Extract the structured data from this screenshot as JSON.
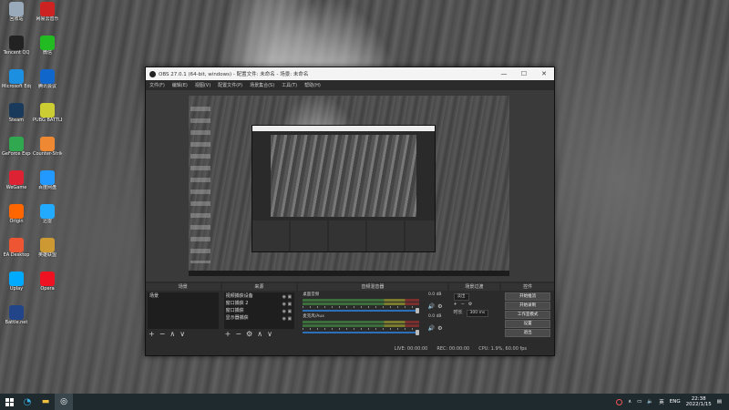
{
  "window": {
    "title": "OBS 27.0.1 (64-bit, windows) - 配置文件: 未命名 - 场景: 未命名",
    "min_glyph": "—",
    "max_glyph": "☐",
    "close_glyph": "✕"
  },
  "menu": [
    "文件(F)",
    "编辑(E)",
    "视图(V)",
    "配置文件(P)",
    "场景集合(S)",
    "工具(T)",
    "帮助(H)"
  ],
  "docks": {
    "scenes": {
      "title": "场景",
      "items": [
        "场景"
      ]
    },
    "sources": {
      "title": "来源",
      "items": [
        "视频捕获设备",
        "窗口捕获 2",
        "窗口捕获",
        "显示器捕获"
      ]
    },
    "mixer": {
      "title": "音频混音器",
      "channels": [
        {
          "name": "桌面音频",
          "db": "0.0 dB",
          "level": 0.9
        },
        {
          "name": "麦克风/Aux",
          "db": "0.0 dB",
          "level": 0.9
        }
      ]
    },
    "transitions": {
      "title": "场景过渡",
      "type": "淡出",
      "duration_label": "时长",
      "duration": "300 ms"
    },
    "controls": {
      "title": "控件",
      "buttons": [
        "开始推流",
        "开始录制",
        "工作室模式",
        "设置",
        "退出"
      ]
    }
  },
  "tool_glyphs": {
    "add": "+",
    "remove": "−",
    "up": "∧",
    "down": "∨",
    "gear": "⚙"
  },
  "status": {
    "live": "LIVE: 00:00:00",
    "rec": "REC: 00:00:00",
    "cpu": "CPU: 1.9%, 60.00 fps"
  },
  "desktop_icons": [
    "回收站",
    "Tencent QQ",
    "Microsoft Edge",
    "Steam",
    "GeForce Experience",
    "WeGame",
    "Origin",
    "EA Desktop",
    "Uplay",
    "Battle.net",
    "网易云音乐",
    "微信",
    "腾讯会议",
    "PUBG BATTLEGROUNDS",
    "Counter-Strike",
    "百度网盘",
    "迅雷",
    "英雄联盟",
    "Opera"
  ],
  "taskbar": {
    "time": "22:38",
    "date": "2022/1/15",
    "lang": "英",
    "tray_text": "ENG"
  }
}
